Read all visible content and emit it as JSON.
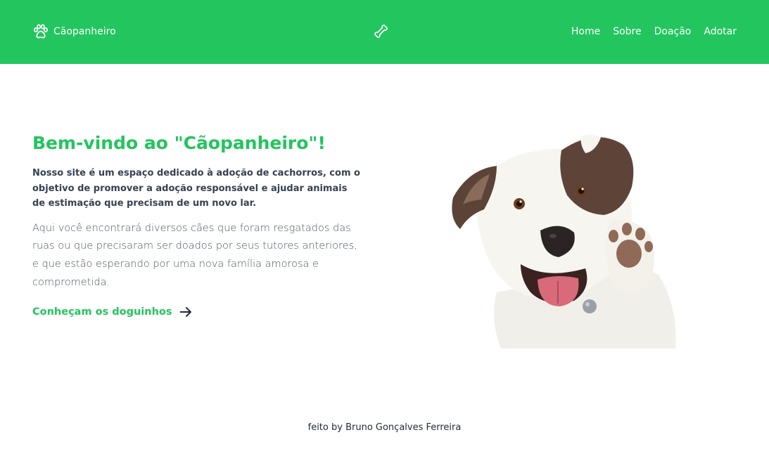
{
  "header": {
    "brand": {
      "label": "Cãopanheiro",
      "icon": "paw-icon"
    },
    "center_icon": "bone-icon",
    "nav": [
      {
        "label": "Home"
      },
      {
        "label": "Sobre"
      },
      {
        "label": "Doação"
      },
      {
        "label": "Adotar"
      }
    ],
    "bg_color": "#22c55e"
  },
  "hero": {
    "title": "Bem-vindo ao \"Cãopanheiro\"!",
    "lead": "Nosso site é um espaço dedicado à adoção de cachorros, com o objetivo de promover a adoção responsável e ajudar animais de estimação que precisam de um novo lar.",
    "body": "Aqui você encontrará diversos cães que foram resgatados das ruas ou que precisaram ser doados por seus tutores anteriores, e que estão esperando por uma nova família amorosa e comprometida.",
    "cta": {
      "label": "Conheçam os doguinhos",
      "icon": "arrow-right-icon"
    },
    "image": "dog-waving-photo",
    "accent_color": "#22c55e"
  },
  "footer": {
    "credit": "feito by Bruno Gonçalves Ferreira"
  }
}
